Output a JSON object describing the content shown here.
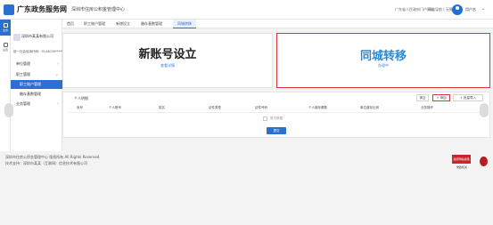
{
  "header": {
    "brand": "广东政务服务网",
    "subtitle": "深圳市住房公积金管理中心",
    "right_link_1": "广东省人民政府门户网站",
    "right_link_2": "网站导航 | 无障碍",
    "user_name": "用户名",
    "accent": "#2b6fd3"
  },
  "rail": {
    "items": [
      {
        "label": "业务",
        "icon": "grid-icon"
      },
      {
        "label": "设置",
        "icon": "settings-icon"
      }
    ]
  },
  "sidebar": {
    "company_name": "深圳市某某有限公司",
    "credit_code": "统一社会信用代码：9144030*******",
    "menu": [
      {
        "label": "单位管理",
        "chevron": "›"
      },
      {
        "label": "职工管理",
        "chevron": "⌄"
      },
      {
        "label": "职工账户管理",
        "chevron": ""
      },
      {
        "label": "缴存基数管理",
        "chevron": ""
      },
      {
        "label": "业务管理",
        "chevron": "›"
      }
    ]
  },
  "tabs": [
    {
      "label": "首页"
    },
    {
      "label": "职工账户管理"
    },
    {
      "label": "新增设立"
    },
    {
      "label": "缴存基数管理"
    },
    {
      "label": "同城转移"
    }
  ],
  "cards": {
    "left_title": "新账号设立",
    "left_link": "查看详情",
    "right_title": "同城转移",
    "right_link": "办理中"
  },
  "panel": {
    "title": "个人明细",
    "buttons": [
      "清空",
      "+ 添加",
      "+ 批量导入"
    ],
    "columns": [
      "序号",
      "个人账号",
      "姓名",
      "证件类型",
      "证件号码",
      "个人缴存基数",
      "单位缴存比例",
      "业务操作"
    ],
    "empty_text": "暂无数据",
    "submit_label": "提交"
  },
  "footer": {
    "line1": "深圳市住房公积金管理中心 版权所有 All Rights Reserved.",
    "line2": "技术支持：深圳市某某（互联网）信息技术有限公司",
    "badge1_title": "政府网站找错",
    "badge1_label": "党政机关"
  }
}
